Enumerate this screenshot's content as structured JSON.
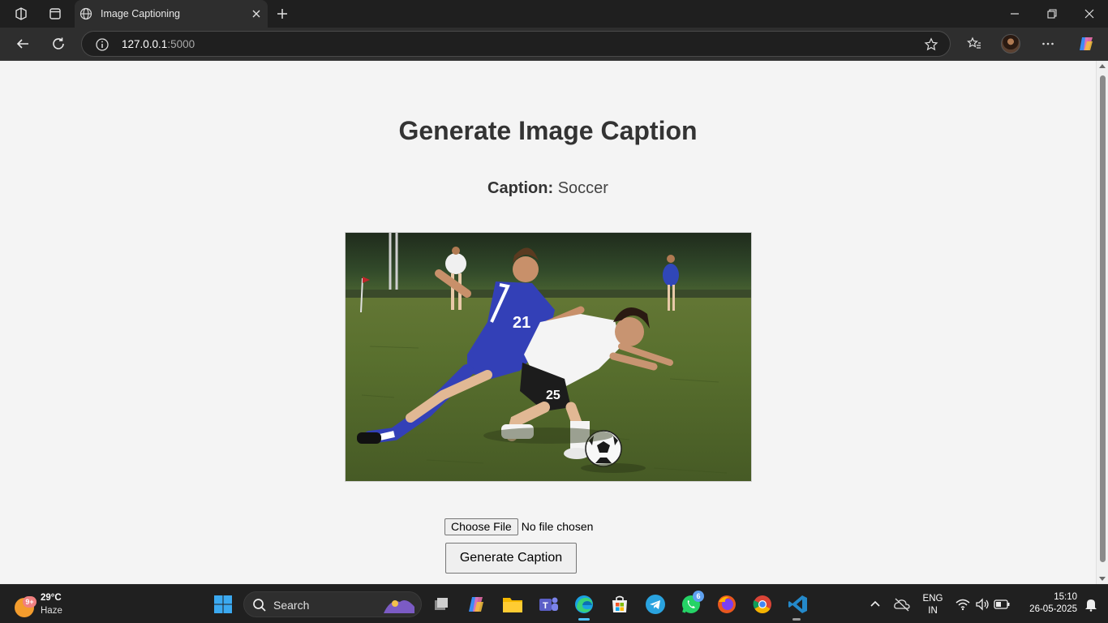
{
  "browser": {
    "tab_title": "Image Captioning",
    "url_host": "127.0.0.1",
    "url_port": ":5000"
  },
  "page": {
    "heading": "Generate Image Caption",
    "caption_label": "Caption:",
    "caption_value": "Soccer",
    "photo_alt": "Two soccer players colliding over a ball on a grass field",
    "file_button_label": "Choose File",
    "file_status": "No file chosen",
    "generate_label": "Generate Caption"
  },
  "taskbar": {
    "weather_badge": "9+",
    "temperature": "29°C",
    "condition": "Haze",
    "search_label": "Search",
    "teams_badge": "",
    "whatsapp_badge": "6",
    "language": "ENG",
    "region": "IN",
    "time": "15:10",
    "date": "26-05-2025"
  },
  "colors": {
    "page_bg": "#f4f4f4",
    "heading": "#333333",
    "chrome_bg": "#1f1f1f",
    "accent": "#4cc2ff"
  }
}
